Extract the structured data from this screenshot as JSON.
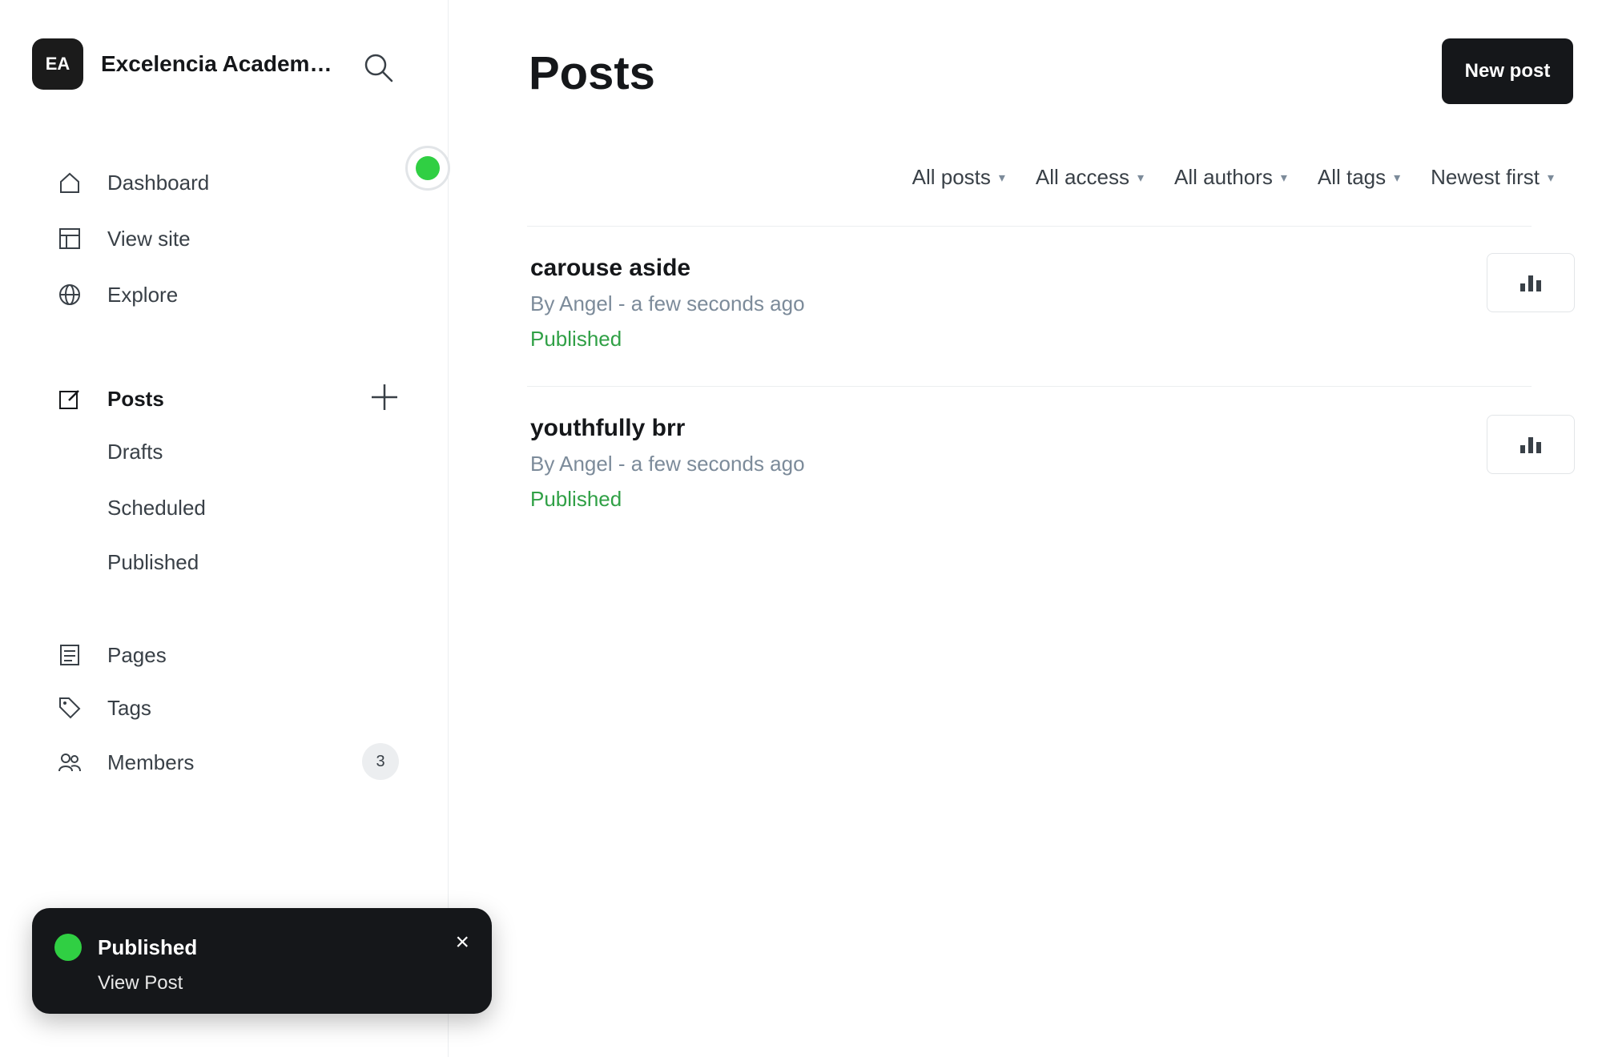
{
  "sidebar": {
    "site_name": "Excelencia Academica hardy-m022...",
    "logo_initials": "EA",
    "nav_top": [
      {
        "label": "Dashboard",
        "icon": "home-icon"
      },
      {
        "label": "View site",
        "icon": "layout-icon"
      },
      {
        "label": "Explore",
        "icon": "globe-icon"
      }
    ],
    "posts": {
      "label": "Posts",
      "icon": "edit-icon"
    },
    "post_sub": [
      "Drafts",
      "Scheduled",
      "Published"
    ],
    "pages": {
      "label": "Pages",
      "icon": "pages-icon"
    },
    "tags": {
      "label": "Tags",
      "icon": "tag-icon"
    },
    "members": {
      "label": "Members",
      "icon": "members-icon",
      "count": "3"
    }
  },
  "toast": {
    "title": "Published",
    "link": "View Post"
  },
  "main": {
    "title": "Posts",
    "new_post_label": "New post",
    "filters": [
      "All posts",
      "All access",
      "All authors",
      "All tags",
      "Newest first"
    ],
    "posts": [
      {
        "title": "carouse aside",
        "meta": "By Angel - a few seconds ago",
        "status": "Published"
      },
      {
        "title": "youthfully brr",
        "meta": "By Angel - a few seconds ago",
        "status": "Published"
      }
    ]
  },
  "colors": {
    "accent": "#30cf43",
    "dark": "#15171a",
    "muted": "#7c8b9a"
  }
}
